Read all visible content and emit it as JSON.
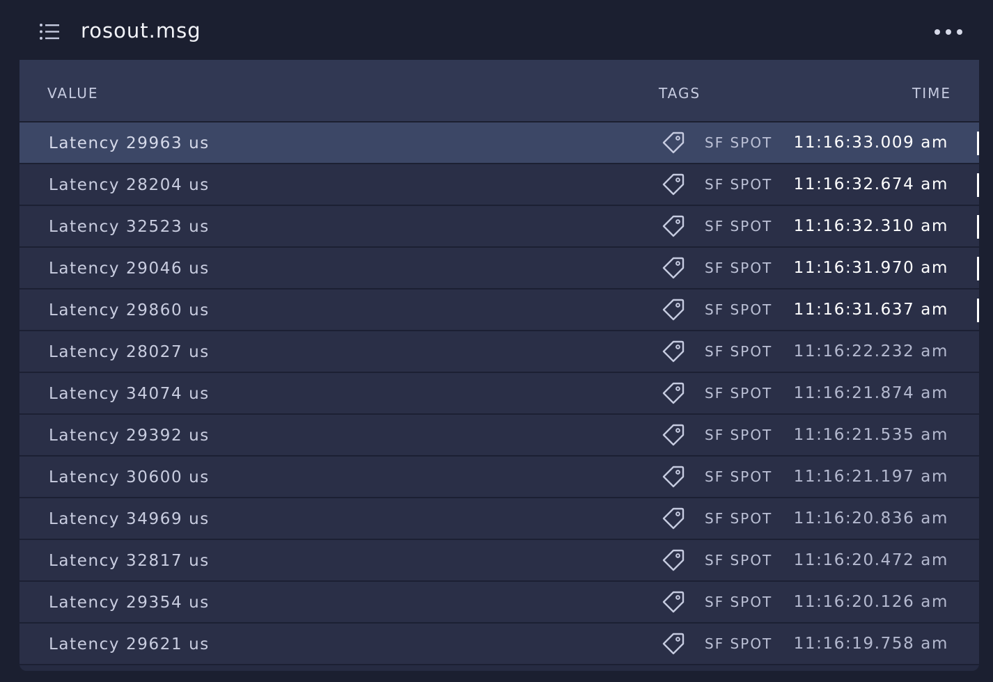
{
  "panel": {
    "title": "rosout.msg",
    "menu_icon": "list-icon",
    "more_icon": "more-horizontal-icon"
  },
  "table": {
    "columns": {
      "value": "VALUE",
      "tags": "TAGS",
      "time": "TIME"
    },
    "tag_icon": "tag-icon",
    "selected_row": 0,
    "rows": [
      {
        "value": "Latency 29963 us",
        "tag": "SF SPOT",
        "time": "11:16:33.009 am",
        "recent": true
      },
      {
        "value": "Latency 28204 us",
        "tag": "SF SPOT",
        "time": "11:16:32.674 am",
        "recent": true
      },
      {
        "value": "Latency 32523 us",
        "tag": "SF SPOT",
        "time": "11:16:32.310 am",
        "recent": true
      },
      {
        "value": "Latency 29046 us",
        "tag": "SF SPOT",
        "time": "11:16:31.970 am",
        "recent": true
      },
      {
        "value": "Latency 29860 us",
        "tag": "SF SPOT",
        "time": "11:16:31.637 am",
        "recent": true
      },
      {
        "value": "Latency 28027 us",
        "tag": "SF SPOT",
        "time": "11:16:22.232 am",
        "recent": false
      },
      {
        "value": "Latency 34074 us",
        "tag": "SF SPOT",
        "time": "11:16:21.874 am",
        "recent": false
      },
      {
        "value": "Latency 29392 us",
        "tag": "SF SPOT",
        "time": "11:16:21.535 am",
        "recent": false
      },
      {
        "value": "Latency 30600 us",
        "tag": "SF SPOT",
        "time": "11:16:21.197 am",
        "recent": false
      },
      {
        "value": "Latency 34969 us",
        "tag": "SF SPOT",
        "time": "11:16:20.836 am",
        "recent": false
      },
      {
        "value": "Latency 32817 us",
        "tag": "SF SPOT",
        "time": "11:16:20.472 am",
        "recent": false
      },
      {
        "value": "Latency 29354 us",
        "tag": "SF SPOT",
        "time": "11:16:20.126 am",
        "recent": false
      },
      {
        "value": "Latency 29621 us",
        "tag": "SF SPOT",
        "time": "11:16:19.758 am",
        "recent": false
      }
    ]
  }
}
